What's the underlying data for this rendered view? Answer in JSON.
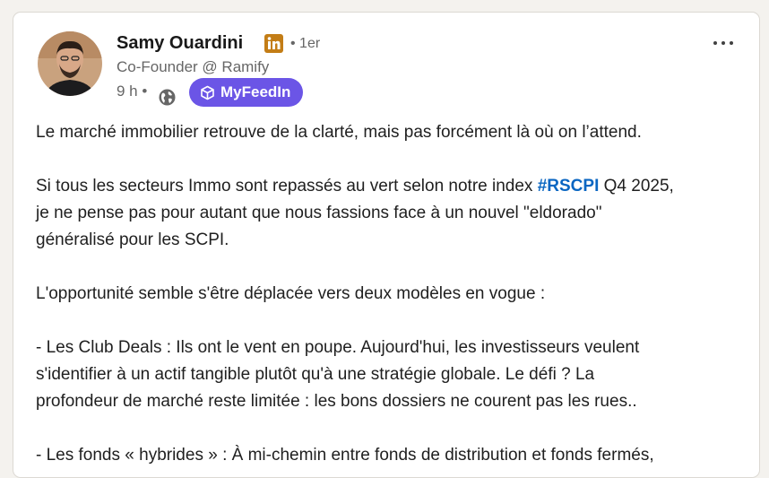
{
  "post": {
    "author": {
      "name": "Samy Ouardini",
      "degree": "• 1er",
      "headline": "Co-Founder @ Ramify"
    },
    "meta": {
      "time": "9 h •",
      "badge_label": "MyFeedIn"
    },
    "icons": {
      "linkedin": "linkedin-premium-icon",
      "visibility": "globe-icon",
      "badge": "cube-icon",
      "more": "ellipsis-icon"
    },
    "colors": {
      "badge": "#6b55e6",
      "hashtag": "#0a66c2",
      "linkedin_icon": "#c37d16"
    },
    "content": {
      "line1": "Le marché immobilier retrouve de la clarté, mais pas forcément là où on l’attend.",
      "p2_part1": "Si tous les secteurs Immo sont repassés au vert selon notre index ",
      "p2_hashtag": "#RSCPI",
      "p2_part2": " Q4 2025,",
      "p2_line2": "je ne pense pas pour autant que nous fassions face à un nouvel \"eldorado\"",
      "p2_line3": "généralisé pour les SCPI.",
      "line_opportunity": "L'opportunité semble s'être déplacée vers deux modèles en vogue :",
      "club_line1": "- Les Club Deals : Ils ont le vent en poupe. Aujourd'hui, les investisseurs veulent",
      "club_line2": "s'identifier à un actif tangible plutôt qu'à une stratégie globale. Le défi ? La",
      "club_line3": "profondeur de marché reste limitée : les bons dossiers ne courent pas les rues..",
      "funds_line1": "- Les fonds « hybrides » : À mi-chemin entre fonds de distribution et fonds fermés,"
    }
  }
}
